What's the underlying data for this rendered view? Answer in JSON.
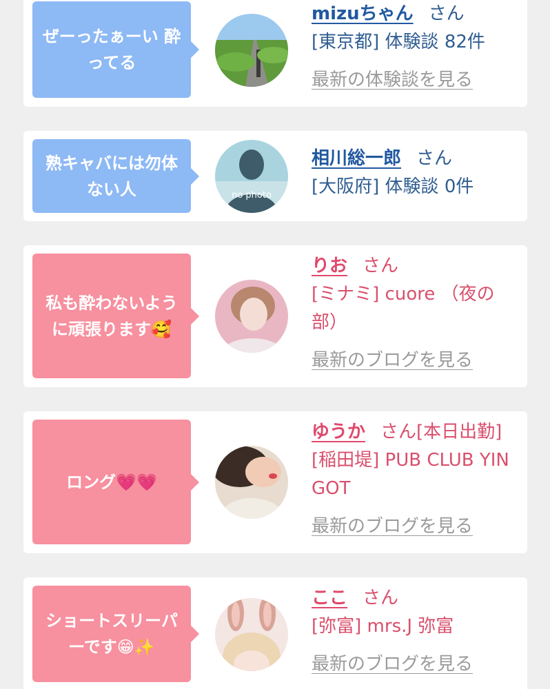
{
  "colors": {
    "blue_bubble": "#8db9f5",
    "pink_bubble": "#f7909f",
    "blue_text": "#2f5d91",
    "pink_text": "#d94f6c",
    "link_gray": "#9a9a9a"
  },
  "entries": [
    {
      "bubble_text": "ぜーったぁーい 酔\nってる",
      "name": "mizuちゃん",
      "san": "さん",
      "suffix": "",
      "detail": "[東京都] 体験談 82件",
      "link": "最新の体験談を見る",
      "avatar_icon": "road-landscape-photo"
    },
    {
      "bubble_text": "熟キャバには勿体\nない人",
      "name": "相川総一郎",
      "san": "さん",
      "suffix": "",
      "detail": "[大阪府] 体験談 0件",
      "link": "",
      "avatar_icon": "no-photo-silhouette",
      "avatar_label": "no photo"
    },
    {
      "bubble_text": "私も酔わないよう\nに頑張ります🥰",
      "name": "りお",
      "san": "さん",
      "suffix": "",
      "detail": "[ミナミ] cuore （夜の部）",
      "link": "最新のブログを見る",
      "avatar_icon": "woman-portrait-photo"
    },
    {
      "bubble_text": "ロング💗💗",
      "name": "ゆうか",
      "san": "さん",
      "suffix": "[本日出勤]",
      "detail": "[稲田堤] PUB CLUB YIN GOT",
      "link": "最新のブログを見る",
      "avatar_icon": "woman-closeup-photo"
    },
    {
      "bubble_text": "ショートスリーパ\nーです😁✨",
      "name": "ここ",
      "san": "さん",
      "suffix": "",
      "detail": "[弥富] mrs.J 弥富",
      "link": "最新のブログを見る",
      "avatar_icon": "bunny-ears-photo"
    }
  ]
}
